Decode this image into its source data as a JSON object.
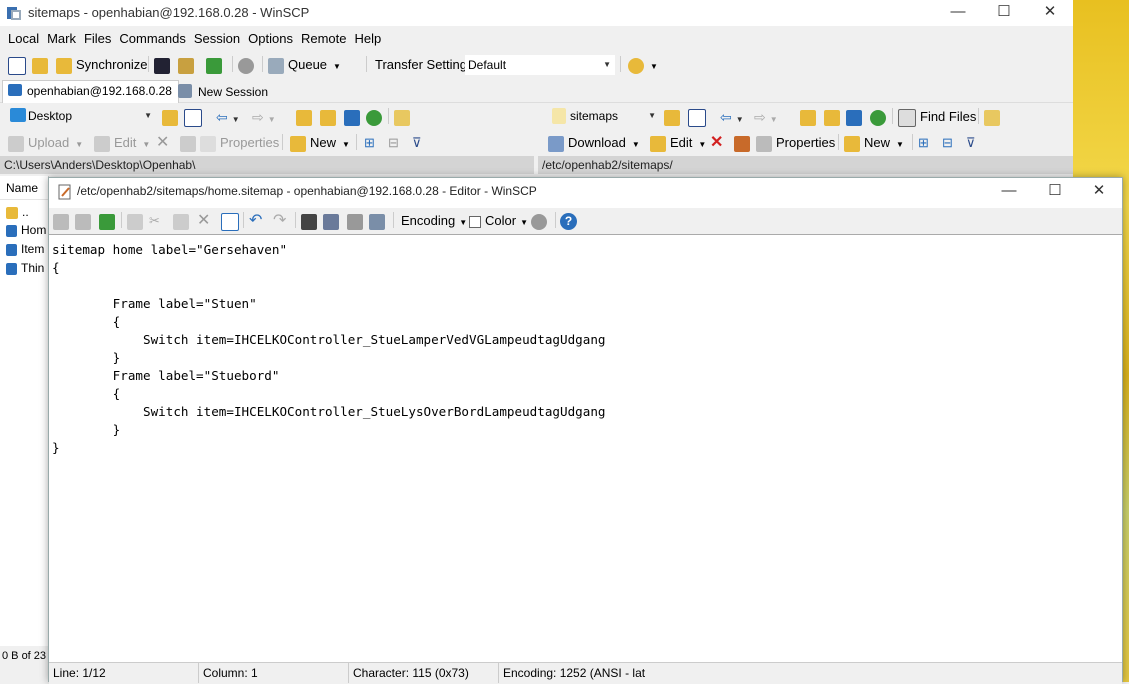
{
  "main_window": {
    "title": "sitemaps - openhabian@192.168.0.28 - WinSCP",
    "controls": {
      "minimize": "—",
      "maximize": "☐",
      "close": "✕"
    }
  },
  "menu": [
    "Local",
    "Mark",
    "Files",
    "Commands",
    "Session",
    "Options",
    "Remote",
    "Help"
  ],
  "toolbar": {
    "synchronize": "Synchronize",
    "queue": "Queue",
    "transfer_settings_label": "Transfer Settings",
    "transfer_settings_value": "Default"
  },
  "sessions": {
    "active": "openhabian@192.168.0.28",
    "new_session": "New Session"
  },
  "left_pane": {
    "location": "Desktop",
    "commands": {
      "upload": "Upload",
      "edit": "Edit",
      "properties": "Properties",
      "new": "New"
    },
    "path": "C:\\Users\\Anders\\Desktop\\Openhab\\",
    "column_name": "Name",
    "items": [
      "..",
      "Hom",
      "Item",
      "Thin"
    ],
    "status": "0 B of 23"
  },
  "right_pane": {
    "location": "sitemaps",
    "find_files": "Find Files",
    "commands": {
      "download": "Download",
      "edit": "Edit",
      "properties": "Properties",
      "new": "New"
    },
    "path": "/etc/openhab2/sitemaps/"
  },
  "editor": {
    "title": "/etc/openhab2/sitemaps/home.sitemap - openhabian@192.168.0.28 - Editor - WinSCP",
    "controls": {
      "minimize": "—",
      "maximize": "☐",
      "close": "✕"
    },
    "toolbar": {
      "encoding": "Encoding",
      "color": "Color",
      "help": "?"
    },
    "content": "sitemap home label=\"Gersehaven\"\n{\n\n        Frame label=\"Stuen\"\n        {\n            Switch item=IHCELKOController_StueLamperVedVGLampeudtagUdgang\n        }\n        Frame label=\"Stuebord\"\n        {\n            Switch item=IHCELKOController_StueLysOverBordLampeudtagUdgang\n        }\n}",
    "status": {
      "line": "Line: 1/12",
      "column": "Column: 1",
      "character": "Character: 115 (0x73)",
      "encoding": "Encoding: 1252  (ANSI - lat"
    }
  },
  "colors": {
    "accent_blue": "#2a6ebb",
    "toolbar_bg": "#f0f0f0",
    "path_bar_bg": "#d4d4d4",
    "folder_yellow": "#e8b93a",
    "refresh_green": "#3a9a3a",
    "delete_red": "#d22020"
  }
}
